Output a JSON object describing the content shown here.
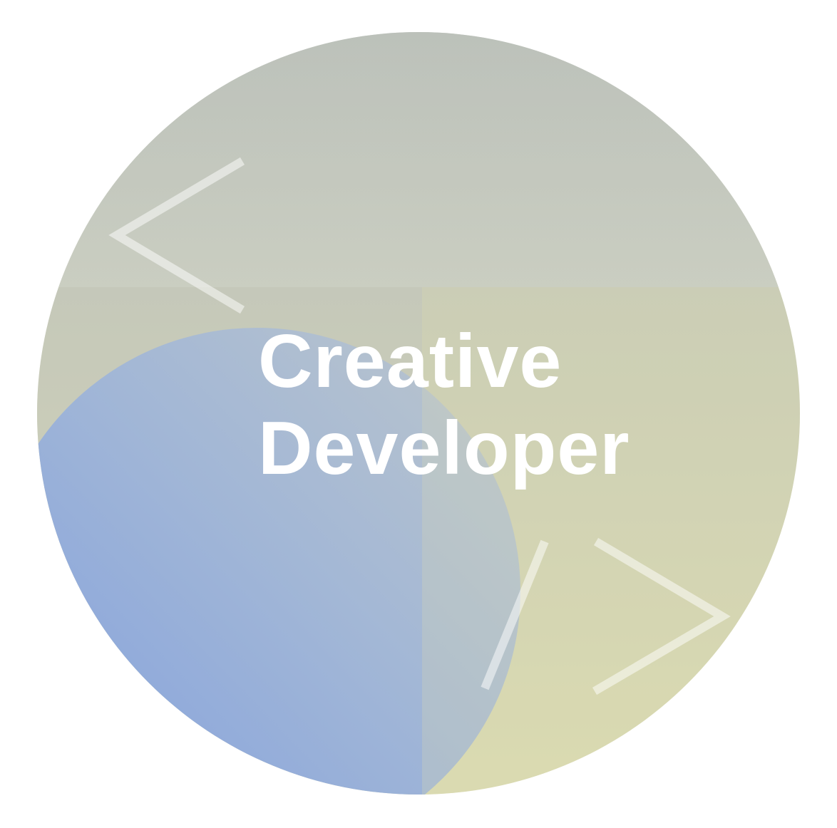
{
  "graphic": {
    "icon": "code-brackets-icon",
    "colors": {
      "top": "#bcc1ba",
      "bottom_right": "#dcdcb0",
      "blue_deep": "#7c9ee2",
      "blue_light": "#b0c1d3",
      "glyph_stroke": "#ffffff"
    }
  },
  "headline": {
    "line1": "Creative",
    "line2": "Developer"
  }
}
